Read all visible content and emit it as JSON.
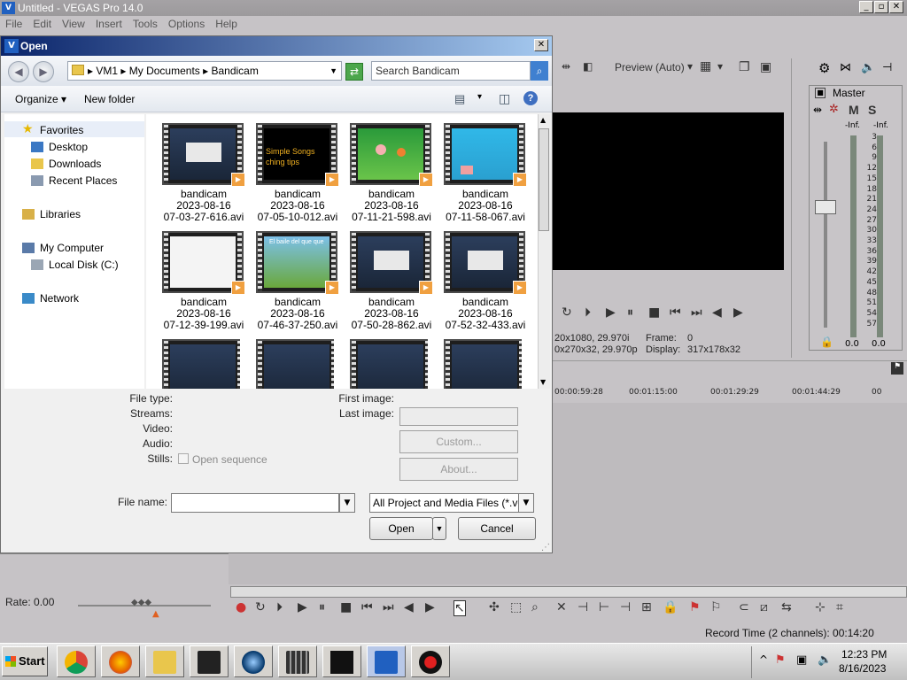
{
  "app": {
    "title": "Untitled - VEGAS Pro 14.0",
    "logo_text": "V",
    "window_buttons": [
      "_",
      "▫",
      "✕"
    ],
    "menu": [
      "File",
      "Edit",
      "View",
      "Insert",
      "Tools",
      "Options",
      "Help"
    ]
  },
  "preview": {
    "mode_label": "Preview (Auto)",
    "info_line1_left": "20x1080, 29.970i",
    "info_line1_right_label": "Frame:",
    "info_line1_right_value": "0",
    "info_line2_left": "0x270x32, 29.970p",
    "info_line2_right_label": "Display:",
    "info_line2_right_value": "317x178x32"
  },
  "master": {
    "label": "Master",
    "m_label": "M",
    "s_label": "S",
    "inf_left": "-Inf.",
    "inf_right": "-Inf.",
    "scale": [
      "3",
      "6",
      "9",
      "12",
      "15",
      "18",
      "21",
      "24",
      "27",
      "30",
      "33",
      "36",
      "39",
      "42",
      "45",
      "48",
      "51",
      "54",
      "57"
    ],
    "bottom_left": "0.0",
    "bottom_right": "0.0"
  },
  "timeline": {
    "ruler": [
      "00:00:59:28",
      "00:01:15:00",
      "00:01:29:29",
      "00:01:44:29",
      "00"
    ],
    "rate_label": "Rate: 0.00",
    "record_time": "Record Time (2 channels): 00:14:20"
  },
  "taskbar": {
    "start_label": "Start",
    "clock_time": "12:23 PM",
    "clock_date": "8/16/2023",
    "tray_arrow": "^"
  },
  "dialog": {
    "title": "Open",
    "breadcrumb": [
      "VM1",
      "My Documents",
      "Bandicam"
    ],
    "search_placeholder": "Search Bandicam",
    "organize_label": "Organize",
    "new_folder_label": "New folder",
    "nav": {
      "favorites": "Favorites",
      "desktop": "Desktop",
      "downloads": "Downloads",
      "recent_places": "Recent Places",
      "libraries": "Libraries",
      "my_computer": "My Computer",
      "local_disk": "Local Disk (C:)",
      "network": "Network"
    },
    "files": [
      {
        "label": "bandicam\n2023-08-16\n07-03-27-616.avi",
        "thumb": "dark-ui"
      },
      {
        "label": "bandicam\n2023-08-16\n07-05-10-012.avi",
        "thumb": "simple-songs",
        "thumb_text": "Simple Songs\nching tips"
      },
      {
        "label": "bandicam\n2023-08-16\n07-11-21-598.avi",
        "thumb": "green-cartoon"
      },
      {
        "label": "bandicam\n2023-08-16\n07-11-58-067.avi",
        "thumb": "blue-cartoon"
      },
      {
        "label": "bandicam\n2023-08-16\n07-12-39-199.avi",
        "thumb": "white-doc"
      },
      {
        "label": "bandicam\n2023-08-16\n07-46-37-250.avi",
        "thumb": "duck-cartoon",
        "thumb_text": "El baile del que que"
      },
      {
        "label": "bandicam\n2023-08-16\n07-50-28-862.avi",
        "thumb": "dark-ui"
      },
      {
        "label": "bandicam\n2023-08-16\n07-52-32-433.avi",
        "thumb": "dark-ui"
      },
      {
        "label": "",
        "thumb": "dark-ui"
      },
      {
        "label": "",
        "thumb": "dark-ui"
      },
      {
        "label": "",
        "thumb": "dark-ui"
      },
      {
        "label": "",
        "thumb": "dark-ui"
      }
    ],
    "info": {
      "file_type": "File type:",
      "streams": "Streams:",
      "video": "Video:",
      "audio": "Audio:",
      "stills": "Stills:",
      "open_sequence": "Open sequence",
      "first_image": "First image:",
      "last_image": "Last image:",
      "custom_button": "Custom...",
      "about_button": "About..."
    },
    "file_name_label": "File name:",
    "file_name_value": "",
    "file_type_value": "All Project and Media Files (*.ve",
    "open_button": "Open",
    "cancel_button": "Cancel"
  }
}
